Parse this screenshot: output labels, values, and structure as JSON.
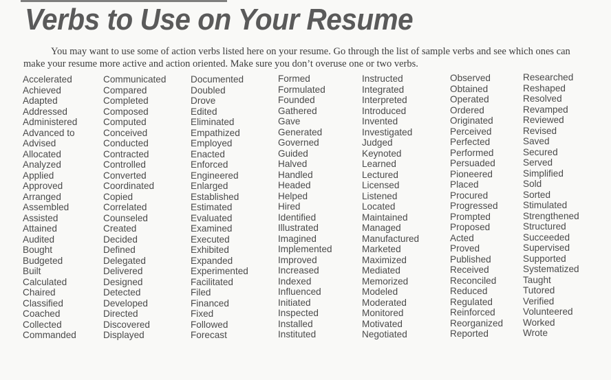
{
  "document": {
    "title": "Verbs to Use on Your Resume",
    "intro": "You may want to use some of action verbs listed here on your resume.  Go through the list of sample verbs and see which ones can make your resume more active and action oriented.  Make sure you don’t overuse one or two verbs."
  },
  "columns": [
    [
      "Accelerated",
      "Achieved",
      "Adapted",
      "Addressed",
      "Administered",
      "Advanced to",
      "Advised",
      "Allocated",
      "Analyzed",
      "Applied",
      "Approved",
      "Arranged",
      "Assembled",
      "Assisted",
      "Attained",
      "Audited",
      "Bought",
      "Budgeted",
      "Built",
      "Calculated",
      "Chaired",
      "Classified",
      "Coached",
      "Collected",
      "Commanded"
    ],
    [
      "Communicated",
      "Compared",
      "Completed",
      "Composed",
      "Computed",
      "Conceived",
      "Conducted",
      "Contracted",
      "Controlled",
      "Converted",
      "Coordinated",
      "Copied",
      "Correlated",
      "Counseled",
      "Created",
      "Decided",
      "Defined",
      "Delegated",
      "Delivered",
      "Designed",
      "Detected",
      "Developed",
      "Directed",
      "Discovered",
      "Displayed"
    ],
    [
      "Documented",
      "Doubled",
      "Drove",
      "Edited",
      "Eliminated",
      "Empathized",
      "Employed",
      "Enacted",
      "Enforced",
      "Engineered",
      "Enlarged",
      "Established",
      "Estimated",
      "Evaluated",
      "Examined",
      "Executed",
      "Exhibited",
      "Expanded",
      "Experimented",
      "Facilitated",
      "Filed",
      "Financed",
      "Fixed",
      "Followed",
      "Forecast"
    ],
    [
      "Formed",
      "Formulated",
      "Founded",
      "Gathered",
      "Gave",
      "Generated",
      "Governed",
      "Guided",
      "Halved",
      "Handled",
      "Headed",
      "Helped",
      "Hired",
      "Identified",
      "Illustrated",
      "Imagined",
      "Implemented",
      "Improved",
      "Increased",
      "Indexed",
      "Influenced",
      "Initiated",
      "Inspected",
      "Installed",
      "Instituted"
    ],
    [
      "Instructed",
      "Integrated",
      "Interpreted",
      "Introduced",
      "Invented",
      "Investigated",
      "Judged",
      "Keynoted",
      "Learned",
      "Lectured",
      "Licensed",
      "Listened",
      "Located",
      "Maintained",
      "Managed",
      "Manufactured",
      "Marketed",
      "Maximized",
      "Mediated",
      "Memorized",
      "Modeled",
      "Moderated",
      "Monitored",
      "Motivated",
      "Negotiated"
    ],
    [
      "Observed",
      "Obtained",
      "Operated",
      "Ordered",
      "Originated",
      "Perceived",
      "Perfected",
      "Performed",
      "Persuaded",
      "Pioneered",
      "Placed",
      "Procured",
      "Progressed",
      "Prompted",
      "Proposed",
      "Acted",
      "Proved",
      "Published",
      "Received",
      "Reconciled",
      "Reduced",
      "Regulated",
      "Reinforced",
      "Reorganized",
      "Reported"
    ],
    [
      "Researched",
      "Reshaped",
      "Resolved",
      "Revamped",
      "Reviewed",
      "Revised",
      "Saved",
      "Secured",
      "Served",
      "Simplified",
      "Sold",
      "Sorted",
      "Stimulated",
      "Strengthened",
      "Structured",
      "Succeeded",
      "Supervised",
      "Supported",
      "Systematized",
      "Taught",
      "Tutored",
      "Verified",
      "Volunteered",
      "Worked",
      "Wrote"
    ]
  ]
}
